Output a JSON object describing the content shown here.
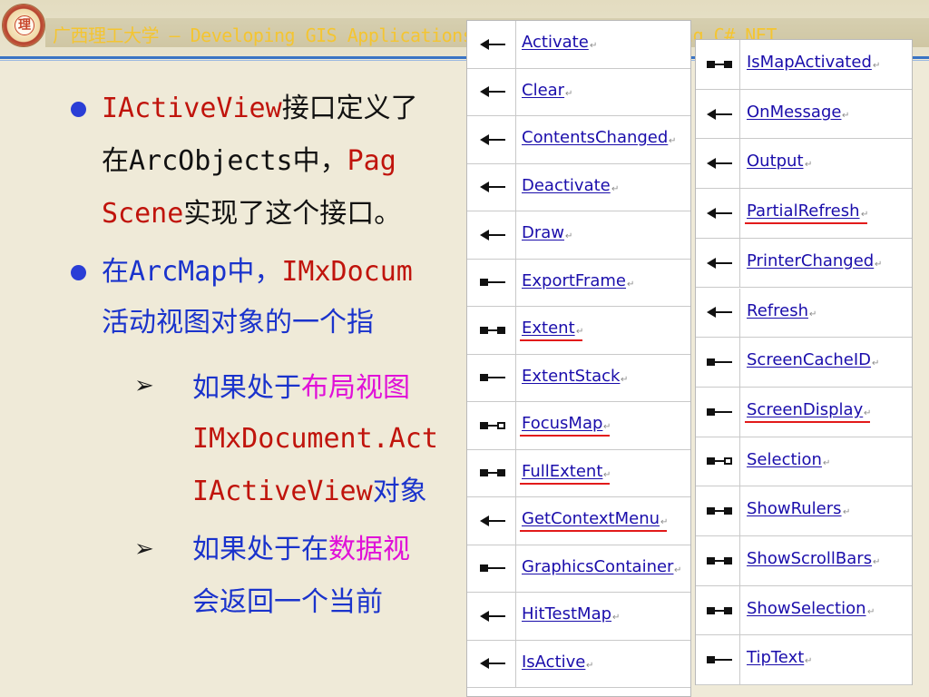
{
  "header": {
    "title": "广西理工大学 — Developing GIS Applications with ArcObjects using C#.NET",
    "logo_text": "理"
  },
  "content": {
    "p1_l1_a": "IActiveView",
    "p1_l1_b": "接口定义了",
    "p1_l2_a": "在ArcObjects中，",
    "p1_l2_b": "Pag",
    "p1_l3_a": "Scene",
    "p1_l3_b": "实现了这个接口。",
    "p2_l1_a": "在ArcMap中，",
    "p2_l1_b": "IMxDocum",
    "p2_l2": "活动视图对象的一个指",
    "s1_l1_a": "如果处于",
    "s1_l1_b": "布局视图",
    "s1_l2": "IMxDocument.Act",
    "s1_l3_a": "IActiveView",
    "s1_l3_b": "对象",
    "s2_l1_a": "如果处于在",
    "s2_l1_b": "数据视",
    "s2_l2": "会返回一个当前",
    "arrow_glyph": "➢"
  },
  "members_left": [
    {
      "name": "Activate",
      "icon": "method-icon",
      "highlight": false
    },
    {
      "name": "Clear",
      "icon": "method-icon",
      "highlight": false
    },
    {
      "name": "ContentsChanged",
      "icon": "method-icon",
      "highlight": false
    },
    {
      "name": "Deactivate",
      "icon": "method-icon",
      "highlight": false
    },
    {
      "name": "Draw",
      "icon": "method-icon",
      "highlight": false
    },
    {
      "name": "ExportFrame",
      "icon": "get-property-icon",
      "highlight": false
    },
    {
      "name": "Extent",
      "icon": "get-set-property-icon",
      "highlight": true
    },
    {
      "name": "ExtentStack",
      "icon": "get-property-icon",
      "highlight": false
    },
    {
      "name": "FocusMap",
      "icon": "get-ref-property-icon",
      "highlight": true
    },
    {
      "name": "FullExtent",
      "icon": "get-set-property-icon",
      "highlight": true
    },
    {
      "name": "GetContextMenu",
      "icon": "method-icon",
      "highlight": true
    },
    {
      "name": "GraphicsContainer",
      "icon": "get-property-icon",
      "highlight": false
    },
    {
      "name": "HitTestMap",
      "icon": "method-icon",
      "highlight": false
    },
    {
      "name": "IsActive",
      "icon": "method-icon",
      "highlight": false
    }
  ],
  "members_right": [
    {
      "name": "IsMapActivated",
      "icon": "get-set-property-icon",
      "highlight": false
    },
    {
      "name": "OnMessage",
      "icon": "method-icon",
      "highlight": false
    },
    {
      "name": "Output",
      "icon": "method-icon",
      "highlight": false
    },
    {
      "name": "PartialRefresh",
      "icon": "method-icon",
      "highlight": true
    },
    {
      "name": "PrinterChanged",
      "icon": "method-icon",
      "highlight": false
    },
    {
      "name": "Refresh",
      "icon": "method-icon",
      "highlight": false
    },
    {
      "name": "ScreenCacheID",
      "icon": "get-property-icon",
      "highlight": false
    },
    {
      "name": "ScreenDisplay",
      "icon": "get-property-icon",
      "highlight": true
    },
    {
      "name": "Selection",
      "icon": "get-ref-property-icon",
      "highlight": false
    },
    {
      "name": "ShowRulers",
      "icon": "get-set-property-icon",
      "highlight": false
    },
    {
      "name": "ShowScrollBars",
      "icon": "get-set-property-icon",
      "highlight": false
    },
    {
      "name": "ShowSelection",
      "icon": "get-set-property-icon",
      "highlight": false
    },
    {
      "name": "TipText",
      "icon": "get-property-icon",
      "highlight": false
    }
  ],
  "return_mark": "↵",
  "colors": {
    "accent_blue": "#1a33cc",
    "accent_red": "#c0140c",
    "accent_magenta": "#e010d8",
    "title_yellow": "#f4c531",
    "link_blue": "#1a0dab",
    "highlight_red": "#e21a1a"
  }
}
